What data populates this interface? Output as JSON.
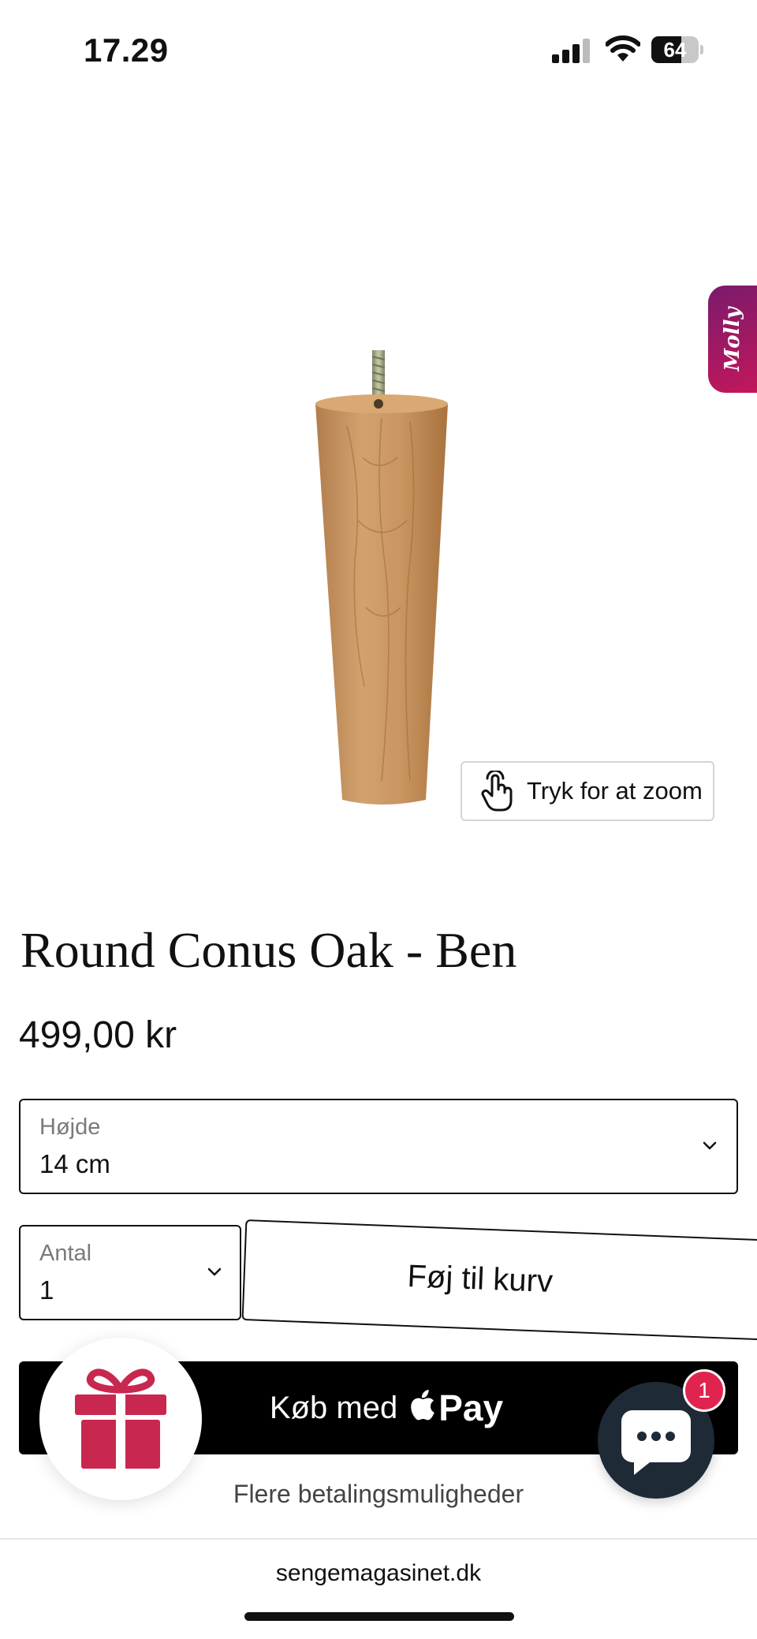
{
  "status_bar": {
    "time": "17.29",
    "battery_level": "64",
    "battery_fraction": 0.64
  },
  "side_tab": {
    "label": "Molly"
  },
  "zoom_button": {
    "label": "Tryk for at zoom",
    "icon": "tap-hand-icon"
  },
  "product": {
    "title": "Round Conus Oak - Ben",
    "price": "499,00 kr"
  },
  "options": {
    "height": {
      "label": "Højde",
      "value": "14 cm"
    },
    "quantity": {
      "label": "Antal",
      "value": "1"
    }
  },
  "buttons": {
    "add_to_cart": "Føj til kurv",
    "apple_pay_prefix": "Køb med",
    "apple_pay_word": "Pay",
    "more_payment": "Flere betalingsmuligheder"
  },
  "chat": {
    "badge_count": "1"
  },
  "browser": {
    "url": "sengemagasinet.dk"
  },
  "colors": {
    "accent": "#c2185b",
    "gift": "#c8284f",
    "chat_bg": "#1f2a37",
    "badge": "#e02450"
  }
}
